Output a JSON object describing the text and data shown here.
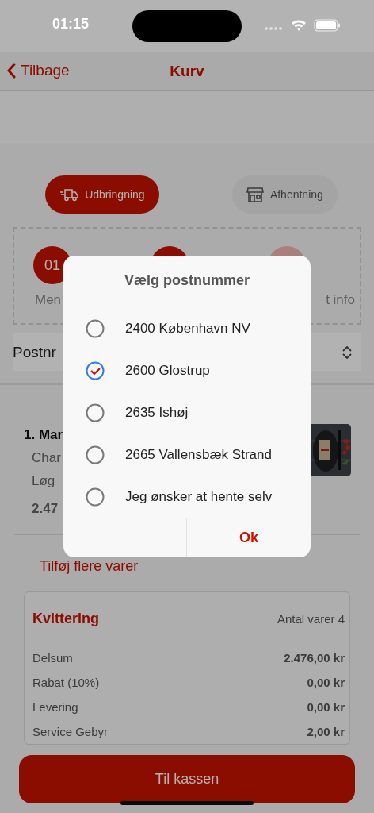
{
  "status_bar": {
    "time": "01:15"
  },
  "nav": {
    "back": "Tilbage",
    "title": "Kurv"
  },
  "delivery_options": [
    {
      "kind": "truck",
      "label": "Udbringning",
      "selected": true
    },
    {
      "kind": "store",
      "label": "Afhentning",
      "selected": false
    }
  ],
  "steps": [
    {
      "number": "01",
      "label": "Men",
      "done": true
    },
    {
      "done": true
    },
    {
      "label": "t info",
      "done": false
    }
  ],
  "postcode_field": {
    "label": "Postnr"
  },
  "cart_item": {
    "title": "1. Mar",
    "line_1": "Char",
    "line_2": "Løg",
    "price": "2.47"
  },
  "add_more": "Tilføj flere varer",
  "receipt": {
    "title": "Kvittering",
    "count": "Antal varer 4",
    "rows": [
      {
        "label": "Delsum",
        "value": "2.476,00 kr"
      },
      {
        "label": "Rabat (10%)",
        "value": "0,00 kr"
      },
      {
        "label": "Levering",
        "value": "0,00 kr"
      },
      {
        "label": "Service Gebyr",
        "value": "2,00 kr"
      }
    ]
  },
  "checkout_button": "Til kassen",
  "dialog": {
    "title": "Vælg postnummer",
    "options": [
      {
        "label": "2400 København NV",
        "selected": false
      },
      {
        "label": "2600 Glostrup",
        "selected": true
      },
      {
        "label": "2635 Ishøj",
        "selected": false
      },
      {
        "label": "2665 Vallensbæk Strand",
        "selected": false
      },
      {
        "label": "Jeg ønsker at hente selv",
        "selected": false
      }
    ],
    "ok": "Ok"
  }
}
